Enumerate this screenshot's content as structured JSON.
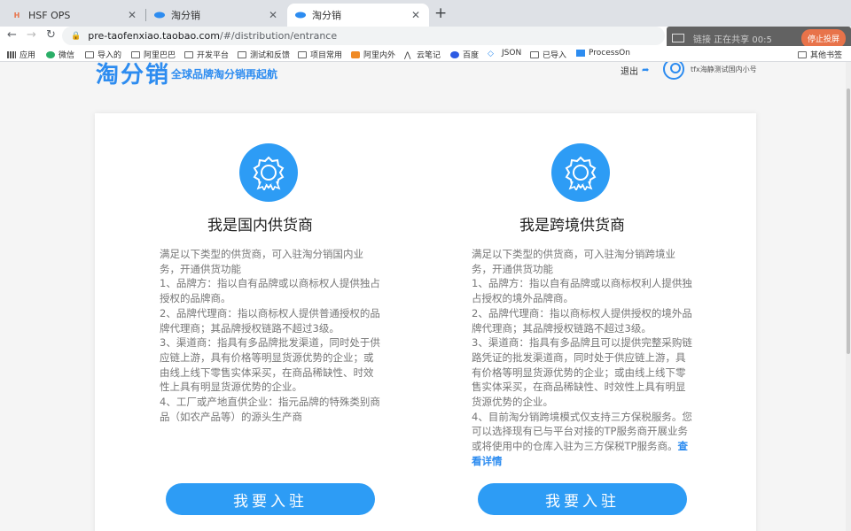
{
  "tabs": [
    {
      "title": "HSF OPS",
      "favicon": "H",
      "active": false
    },
    {
      "title": "淘分销",
      "favicon": "taofenxiao-logo-icon",
      "active": false
    },
    {
      "title": "淘分销",
      "favicon": "taofenxiao-logo-icon",
      "active": true
    }
  ],
  "address": {
    "host": "pre-taofenxiao.taobao.com",
    "path": "/#/distribution/entrance"
  },
  "recording": {
    "text": "链接 正在共享 00:5",
    "stop_label": "停止投屏"
  },
  "bookmarks": [
    {
      "label": "应用",
      "icon": "apps-grid-icon"
    },
    {
      "label": "微信",
      "icon": "wechat-icon"
    },
    {
      "label": "导入的",
      "icon": "folder-icon"
    },
    {
      "label": "阿里巴巴",
      "icon": "folder-icon"
    },
    {
      "label": "开发平台",
      "icon": "folder-icon"
    },
    {
      "label": "测试和反馈",
      "icon": "folder-icon"
    },
    {
      "label": "项目常用",
      "icon": "folder-icon"
    },
    {
      "label": "阿里内外",
      "icon": "alibaba-icon"
    },
    {
      "label": "云笔记",
      "icon": "note-icon"
    },
    {
      "label": "百度",
      "icon": "baidu-icon"
    },
    {
      "label": "JSON",
      "icon": "json-icon"
    },
    {
      "label": "已导入",
      "icon": "folder-icon"
    },
    {
      "label": "ProcessOn",
      "icon": "processon-icon"
    }
  ],
  "other_bookmarks": "其他书签",
  "header": {
    "logo": "淘分销",
    "slogan": "全球品牌淘分销再起航",
    "logout": "退出",
    "username": "tfx海静测试国内小号"
  },
  "options": [
    {
      "title": "我是国内供货商",
      "lines": [
        "满足以下类型的供货商，可入驻淘分销国内业务，开通供货功能",
        "1、品牌方：指以自有品牌或以商标权人提供独占授权的品牌商。",
        "2、品牌代理商：指以商标权人提供普通授权的品牌代理商；其品牌授权链路不超过3级。",
        "3、渠道商：指具有多品牌批发渠道，同时处于供应链上游，具有价格等明显货源优势的企业；或由线上线下零售实体采买，在商品稀缺性、时效性上具有明显货源优势的企业。",
        "4、工厂或产地直供企业：指元品牌的特殊类别商品（如农产品等）的源头生产商"
      ],
      "button": "我要入驻"
    },
    {
      "title": "我是跨境供货商",
      "lines": [
        "满足以下类型的供货商，可入驻淘分销跨境业务，开通供货功能",
        "1、品牌方：指以自有品牌或以商标权利人提供独占授权的境外品牌商。",
        "2、品牌代理商：指以商标权人提供授权的境外品牌代理商；其品牌授权链路不超过3级。",
        "3、渠道商：指具有多品牌且可以提供完整采购链路凭证的批发渠道商，同时处于供应链上游，具有价格等明显货源优势的企业；或由线上线下零售实体采买，在商品稀缺性、时效性上具有明显货源优势的企业。",
        "4、目前淘分销跨境模式仅支持三方保税服务。您可以选择现有已与平台对接的TP服务商开展业务或将使用中的仓库入驻为三方保税TP服务商。"
      ],
      "detail_link": "查看详情",
      "button": "我要入驻"
    }
  ]
}
